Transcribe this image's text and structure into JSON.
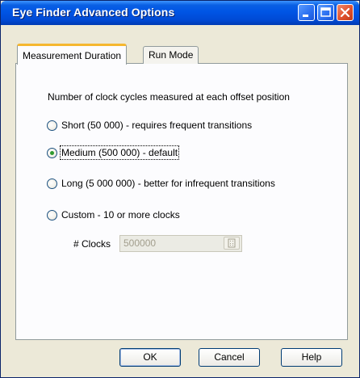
{
  "window": {
    "title": "Eye Finder Advanced Options"
  },
  "tabs": [
    {
      "label": "Measurement Duration",
      "active": true
    },
    {
      "label": "Run Mode",
      "active": false
    }
  ],
  "panel": {
    "intro": "Number of clock cycles measured at each offset position",
    "options": [
      {
        "label": "Short (50 000) - requires frequent transitions",
        "selected": false
      },
      {
        "label": "Medium (500 000) - default",
        "selected": true
      },
      {
        "label": "Long (5 000 000) - better for infrequent transitions",
        "selected": false
      },
      {
        "label": "Custom - 10 or more clocks",
        "selected": false
      }
    ],
    "clocks": {
      "label": "# Clocks",
      "value": "500000",
      "enabled": false
    }
  },
  "buttons": {
    "ok": "OK",
    "cancel": "Cancel",
    "help": "Help"
  },
  "colors": {
    "titlebar": "#0055e5",
    "active_tab_accent": "#f5b72f",
    "radio_selected": "#2f9a2f"
  }
}
